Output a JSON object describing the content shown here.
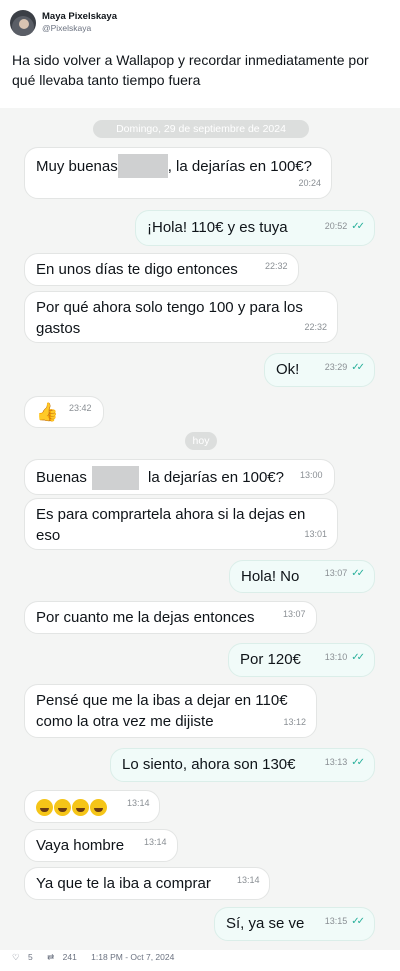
{
  "author": {
    "name": "Maya Pixelskaya",
    "handle": "@Pixelskaya"
  },
  "tweet_text": "Ha sido volver a Wallapop y recordar inmediatamente por qué llevaba tanto tiempo fuera",
  "date_dividers": {
    "first": "Domingo, 29 de septiembre de 2024",
    "today": "hoy"
  },
  "messages": [
    {
      "dir": "in",
      "pre": "Muy buenas",
      "post": ", la dejarías en 100€?",
      "time": "20:24"
    },
    {
      "dir": "out",
      "text": "¡Hola! 110€ y es tuya",
      "time": "20:52"
    },
    {
      "dir": "in",
      "text": "En unos días te digo entonces",
      "time": "22:32"
    },
    {
      "dir": "in",
      "text": "Por qué ahora solo tengo 100 y para los gastos",
      "time": "22:32"
    },
    {
      "dir": "out",
      "text": "Ok!",
      "time": "23:29"
    },
    {
      "dir": "in",
      "icon": "thumbs-up-emoji",
      "time": "23:42"
    },
    {
      "dir": "in",
      "pre": "Buenas",
      "post": " la dejarías en 100€?",
      "time": "13:00"
    },
    {
      "dir": "in",
      "text": "Es para comprartela ahora si la dejas en eso",
      "time": "13:01"
    },
    {
      "dir": "out",
      "text": "Hola! No",
      "time": "13:07"
    },
    {
      "dir": "in",
      "text": "Por cuanto me la dejas entonces",
      "time": "13:07"
    },
    {
      "dir": "out",
      "text": "Por 120€",
      "time": "13:10"
    },
    {
      "dir": "in",
      "text": "Pensé que me la ibas a dejar en 110€ como la otra vez me dijiste",
      "time": "13:12"
    },
    {
      "dir": "out",
      "text": "Lo siento, ahora son 130€",
      "time": "13:13"
    },
    {
      "dir": "in",
      "icon": "laughing-emoji x4",
      "time": "13:14"
    },
    {
      "dir": "in",
      "text": "Vaya hombre",
      "time": "13:14"
    },
    {
      "dir": "in",
      "text": "Ya que te la iba a comprar",
      "time": "13:14"
    },
    {
      "dir": "out",
      "text": "Sí, ya se ve",
      "time": "13:15"
    }
  ],
  "footer": {
    "likes": "5",
    "retweets": "241",
    "timestamp": "1:18 PM - Oct 7, 2024"
  },
  "colors": {
    "read_check": "#29b09b",
    "chat_bg": "#f4f5f4",
    "outgoing_bubble": "#f1fbf9"
  }
}
